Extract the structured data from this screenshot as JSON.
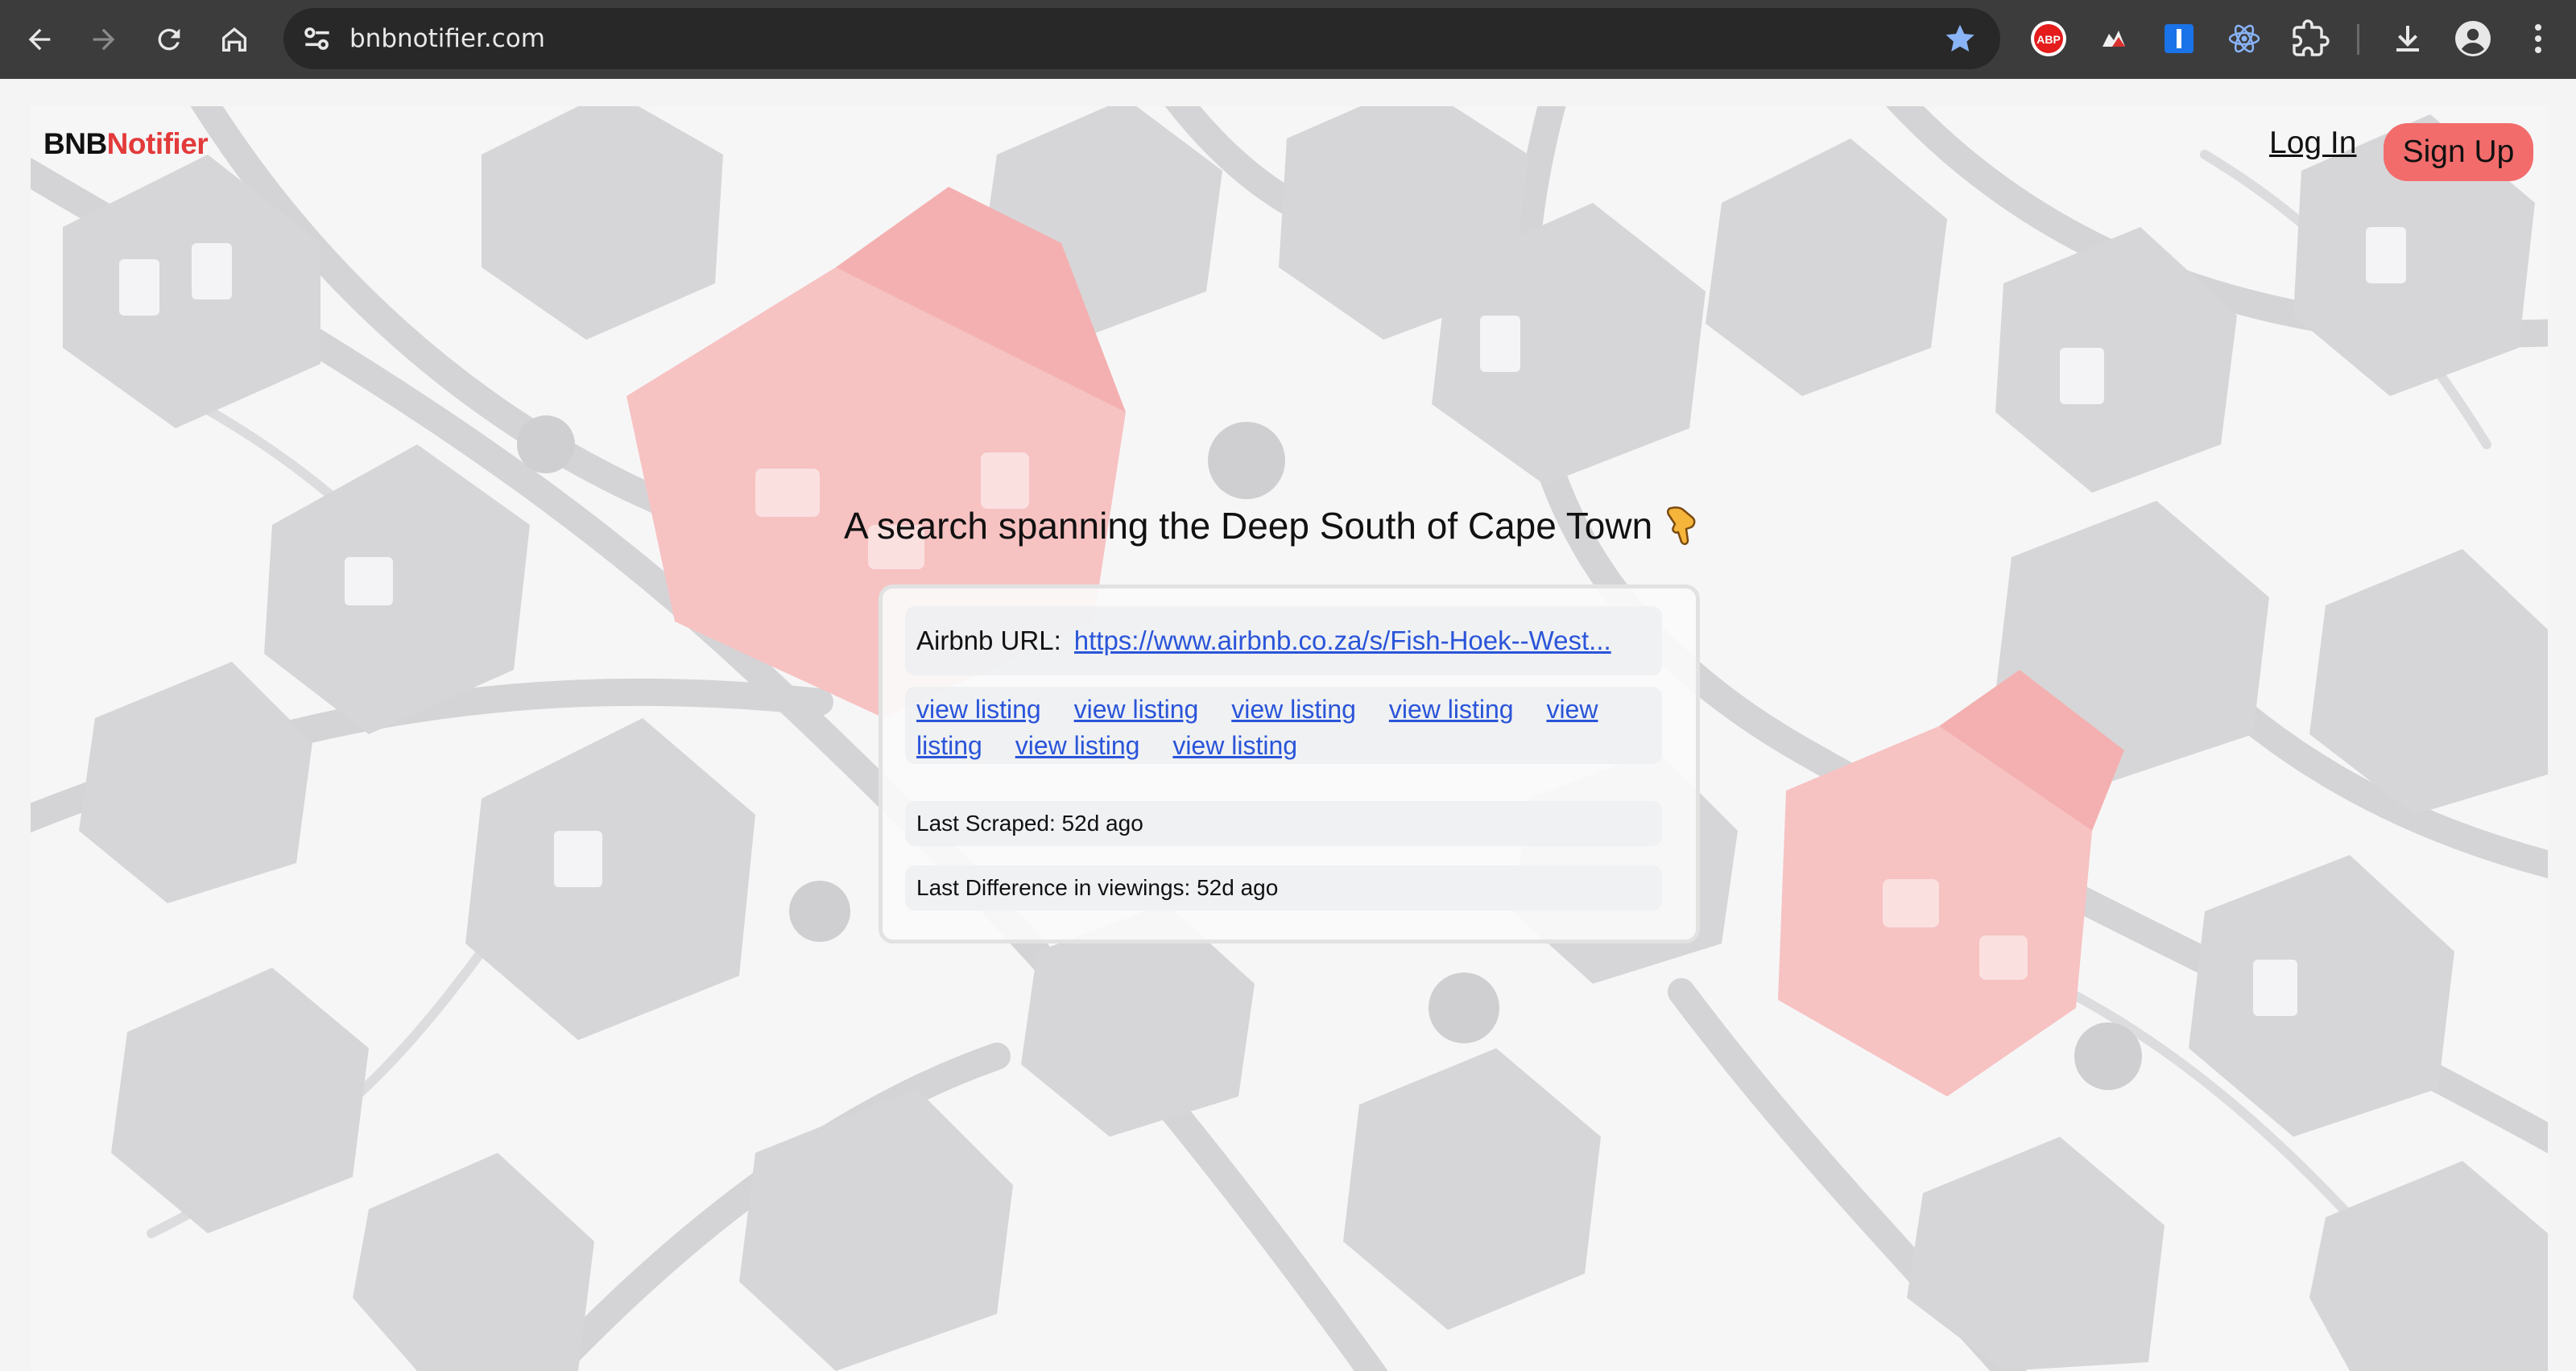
{
  "browser": {
    "url": "bnbnotifier.com",
    "icons": [
      "back-icon",
      "forward-icon",
      "reload-icon",
      "home-icon",
      "site-info-icon",
      "bookmark-star-icon",
      "adblock-icon",
      "extension-icon",
      "extension-icon",
      "react-devtools-icon",
      "extensions-puzzle-icon",
      "download-icon",
      "profile-icon",
      "menu-icon"
    ],
    "adblock_label": "ABP",
    "accent": "#8ab4f8"
  },
  "header": {
    "brand_part1": "BNB",
    "brand_part2": "Notifier",
    "login_label": "Log In",
    "signup_label": "Sign Up",
    "brand_accent": "#e33a3a",
    "signup_color": "#f36c6c"
  },
  "main": {
    "headline": "A search spanning the Deep South of Cape Town",
    "headline_icon": "pointing-down-hand-icon",
    "card": {
      "url_label": "Airbnb URL:",
      "url_value": "https://www.airbnb.co.za/s/Fish-Hoek--West...",
      "listing_links": [
        "view listing",
        "view listing",
        "view listing",
        "view listing",
        "view listing",
        "view listing",
        "view listing"
      ],
      "last_scraped": "Last Scraped: 52d ago",
      "last_difference": "Last Difference in viewings: 52d ago"
    }
  }
}
